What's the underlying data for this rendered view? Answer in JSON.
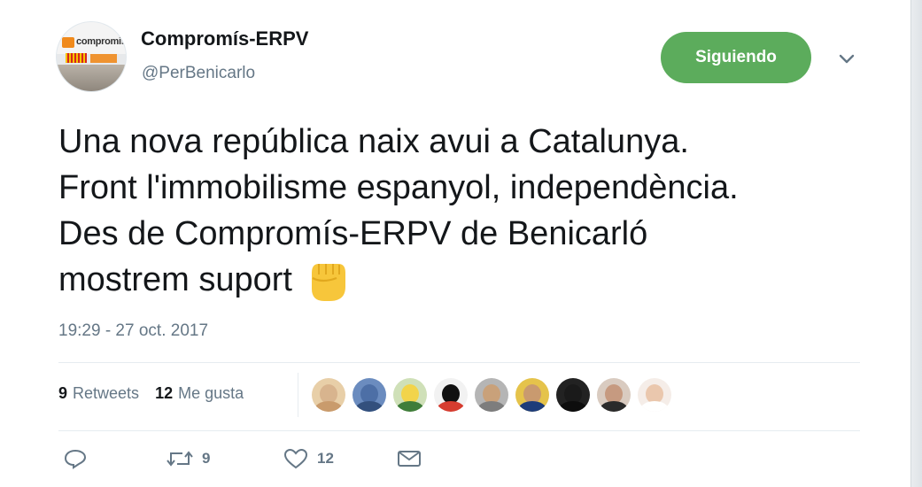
{
  "account": {
    "name": "Compromís-ERPV",
    "handle": "@PerBenicarlo",
    "avatar_brand": "compromis"
  },
  "follow_button": {
    "label": "Siguiendo",
    "color": "#5cac5c"
  },
  "more_menu": {
    "icon": "chevron-down-icon"
  },
  "tweet": {
    "lines": [
      "Una nova república naix avui a Catalunya.",
      "Front l'immobilisme espanyol, independència.",
      "Des de Compromís-ERPV de Benicarló",
      "mostrem suport"
    ],
    "emoji": "✊",
    "timestamp": "19:29 - 27 oct. 2017"
  },
  "stats": {
    "retweets_count": "9",
    "retweets_label": "Retweets",
    "likes_count": "12",
    "likes_label": "Me gusta"
  },
  "likers": [
    {
      "face": "#d8b48e",
      "body": "#c99b6c",
      "bg": "#e8cfa8"
    },
    {
      "face": "#4d6fa6",
      "body": "#33507d",
      "bg": "#6b8cbf"
    },
    {
      "face": "#f2d44a",
      "body": "#3f7d3a",
      "bg": "#cfe0b8"
    },
    {
      "face": "#111111",
      "body": "#d63c2f",
      "bg": "#f2f2f2"
    },
    {
      "face": "#c9a17a",
      "body": "#7d7d7d",
      "bg": "#b5b5b5"
    },
    {
      "face": "#c99a6f",
      "body": "#1d3c7a",
      "bg": "#e5c34b"
    },
    {
      "face": "#1a1a1a",
      "body": "#0d0d0d",
      "bg": "#222222"
    },
    {
      "face": "#c69a80",
      "body": "#2a2a2a",
      "bg": "#d9cbc0"
    },
    {
      "face": "#eac7ad",
      "body": "#ffffff",
      "bg": "#f5ede8"
    }
  ],
  "actions": {
    "reply_icon": "reply-icon",
    "retweet_icon": "retweet-icon",
    "retweet_count": "9",
    "like_icon": "heart-icon",
    "like_count": "12",
    "dm_icon": "envelope-icon"
  },
  "colors": {
    "text": "#14171a",
    "secondary": "#657786",
    "divider": "#e6ecf0",
    "accent_green": "#5cac5c"
  }
}
